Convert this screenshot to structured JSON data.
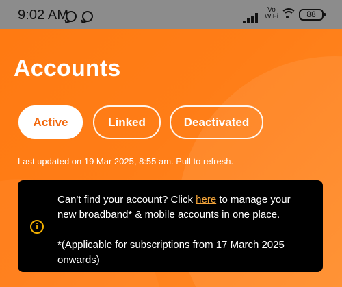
{
  "status_bar": {
    "time": "9:02 AM",
    "network_label_top": "Vo",
    "network_label_bottom": "WiFi",
    "battery": "88"
  },
  "page": {
    "title": "Accounts"
  },
  "tabs": [
    {
      "label": "Active"
    },
    {
      "label": "Linked"
    },
    {
      "label": "Deactivated"
    }
  ],
  "update": {
    "text": "Last updated on 19 Mar 2025, 8:55 am. Pull to refresh."
  },
  "info_card": {
    "line1_before": "Can't find your account? Click ",
    "link": "here",
    "line1_after": " to manage your",
    "line2": "new broadband* & mobile accounts in one place.",
    "note_line1": "*(Applicable for subscriptions from 17 March 2025",
    "note_line2": "onwards)"
  },
  "colors": {
    "primary": "#ff7a12",
    "active_text": "#f26a10",
    "card_bg": "#000000",
    "info_icon": "#f3b000"
  },
  "icons": {
    "whatsapp": "whatsapp-icon",
    "signal": "signal-icon",
    "wifi": "wifi-icon",
    "battery": "battery-icon",
    "info": "info-icon"
  }
}
